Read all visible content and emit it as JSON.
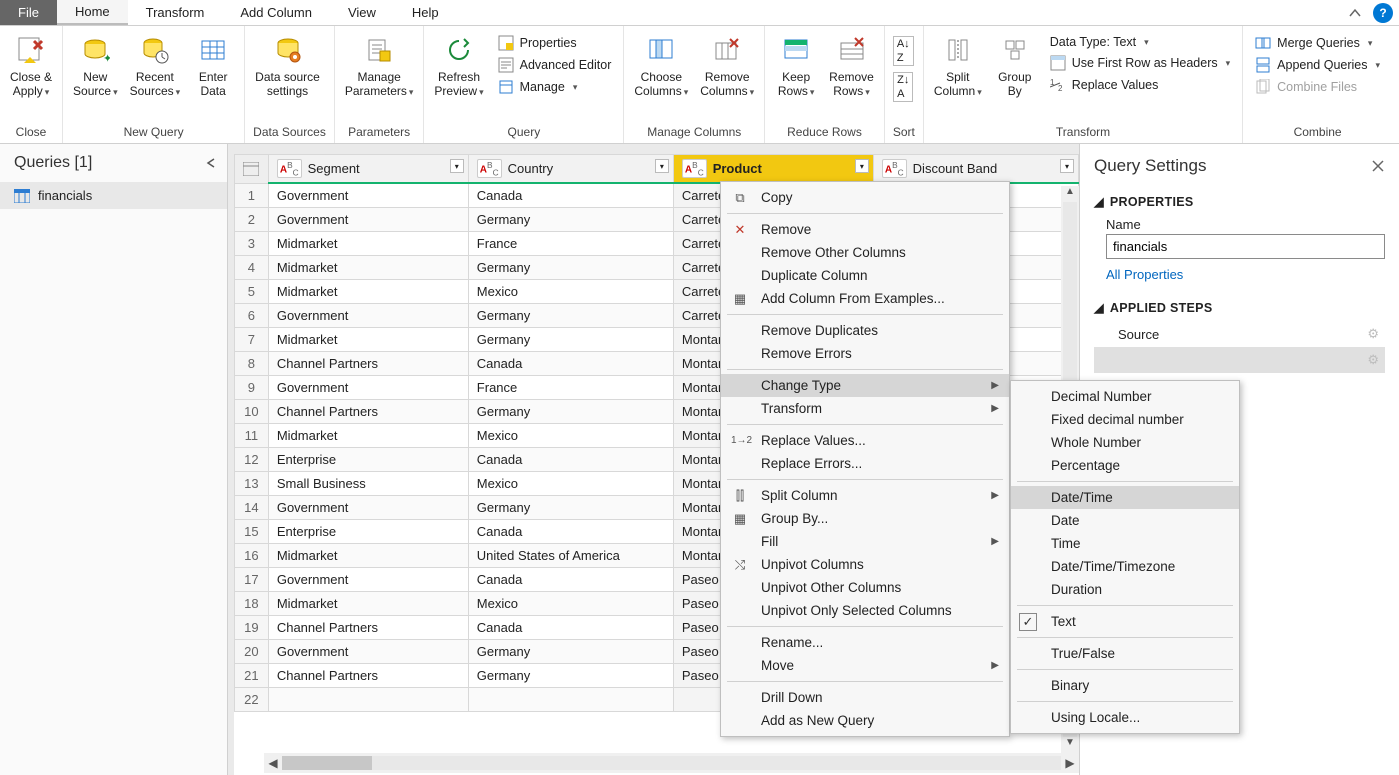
{
  "tabs": {
    "file": "File",
    "home": "Home",
    "transform": "Transform",
    "addcol": "Add Column",
    "view": "View",
    "help": "Help"
  },
  "ribbon": {
    "close": {
      "closeApply": "Close &\nApply",
      "group": "Close"
    },
    "newquery": {
      "newSource": "New\nSource",
      "recentSources": "Recent\nSources",
      "enterData": "Enter\nData",
      "group": "New Query"
    },
    "datasources": {
      "dsSettings": "Data source\nsettings",
      "group": "Data Sources"
    },
    "parameters": {
      "manage": "Manage\nParameters",
      "group": "Parameters"
    },
    "query": {
      "refresh": "Refresh\nPreview",
      "properties": "Properties",
      "advanced": "Advanced Editor",
      "manage": "Manage",
      "group": "Query"
    },
    "managecols": {
      "choose": "Choose\nColumns",
      "remove": "Remove\nColumns",
      "group": "Manage Columns"
    },
    "reducerows": {
      "keep": "Keep\nRows",
      "remove": "Remove\nRows",
      "group": "Reduce Rows"
    },
    "sort": {
      "group": "Sort"
    },
    "transform": {
      "split": "Split\nColumn",
      "groupby": "Group\nBy",
      "datatype": "Data Type: Text",
      "firstrow": "Use First Row as Headers",
      "replace": "Replace Values",
      "group": "Transform"
    },
    "combine": {
      "merge": "Merge Queries",
      "append": "Append Queries",
      "combinefiles": "Combine Files",
      "group": "Combine"
    }
  },
  "queries": {
    "header": "Queries [1]",
    "item1": "financials"
  },
  "columns": {
    "segment": "Segment",
    "country": "Country",
    "product": "Product",
    "discount": "Discount Band"
  },
  "rows": [
    {
      "n": "1",
      "seg": "Government",
      "ctry": "Canada",
      "prod": "Carretera"
    },
    {
      "n": "2",
      "seg": "Government",
      "ctry": "Germany",
      "prod": "Carretera"
    },
    {
      "n": "3",
      "seg": "Midmarket",
      "ctry": "France",
      "prod": "Carretera"
    },
    {
      "n": "4",
      "seg": "Midmarket",
      "ctry": "Germany",
      "prod": "Carretera"
    },
    {
      "n": "5",
      "seg": "Midmarket",
      "ctry": "Mexico",
      "prod": "Carretera"
    },
    {
      "n": "6",
      "seg": "Government",
      "ctry": "Germany",
      "prod": "Carretera"
    },
    {
      "n": "7",
      "seg": "Midmarket",
      "ctry": "Germany",
      "prod": "Montana"
    },
    {
      "n": "8",
      "seg": "Channel Partners",
      "ctry": "Canada",
      "prod": "Montana"
    },
    {
      "n": "9",
      "seg": "Government",
      "ctry": "France",
      "prod": "Montana"
    },
    {
      "n": "10",
      "seg": "Channel Partners",
      "ctry": "Germany",
      "prod": "Montana"
    },
    {
      "n": "11",
      "seg": "Midmarket",
      "ctry": "Mexico",
      "prod": "Montana"
    },
    {
      "n": "12",
      "seg": "Enterprise",
      "ctry": "Canada",
      "prod": "Montana"
    },
    {
      "n": "13",
      "seg": "Small Business",
      "ctry": "Mexico",
      "prod": "Montana"
    },
    {
      "n": "14",
      "seg": "Government",
      "ctry": "Germany",
      "prod": "Montana"
    },
    {
      "n": "15",
      "seg": "Enterprise",
      "ctry": "Canada",
      "prod": "Montana"
    },
    {
      "n": "16",
      "seg": "Midmarket",
      "ctry": "United States of America",
      "prod": "Montana"
    },
    {
      "n": "17",
      "seg": "Government",
      "ctry": "Canada",
      "prod": "Paseo"
    },
    {
      "n": "18",
      "seg": "Midmarket",
      "ctry": "Mexico",
      "prod": "Paseo"
    },
    {
      "n": "19",
      "seg": "Channel Partners",
      "ctry": "Canada",
      "prod": "Paseo"
    },
    {
      "n": "20",
      "seg": "Government",
      "ctry": "Germany",
      "prod": "Paseo"
    },
    {
      "n": "21",
      "seg": "Channel Partners",
      "ctry": "Germany",
      "prod": "Paseo"
    },
    {
      "n": "22",
      "seg": "",
      "ctry": "",
      "prod": ""
    }
  ],
  "settings": {
    "header": "Query Settings",
    "properties": "PROPERTIES",
    "nameLabel": "Name",
    "nameValue": "financials",
    "allProps": "All Properties",
    "appliedSteps": "APPLIED STEPS",
    "step1": "Source",
    "step2": ""
  },
  "ctx1": {
    "copy": "Copy",
    "remove": "Remove",
    "removeOther": "Remove Other Columns",
    "duplicate": "Duplicate Column",
    "addFromEx": "Add Column From Examples...",
    "removeDup": "Remove Duplicates",
    "removeErr": "Remove Errors",
    "changeType": "Change Type",
    "transform": "Transform",
    "replaceVals": "Replace Values...",
    "replaceErrs": "Replace Errors...",
    "split": "Split Column",
    "groupby": "Group By...",
    "fill": "Fill",
    "unpivot": "Unpivot Columns",
    "unpivotOther": "Unpivot Other Columns",
    "unpivotOnly": "Unpivot Only Selected Columns",
    "rename": "Rename...",
    "move": "Move",
    "drilldown": "Drill Down",
    "addNew": "Add as New Query"
  },
  "ctx2": {
    "decimal": "Decimal Number",
    "fixed": "Fixed decimal number",
    "whole": "Whole Number",
    "pct": "Percentage",
    "datetime": "Date/Time",
    "date": "Date",
    "time": "Time",
    "dttz": "Date/Time/Timezone",
    "duration": "Duration",
    "text": "Text",
    "tf": "True/False",
    "binary": "Binary",
    "locale": "Using Locale..."
  }
}
